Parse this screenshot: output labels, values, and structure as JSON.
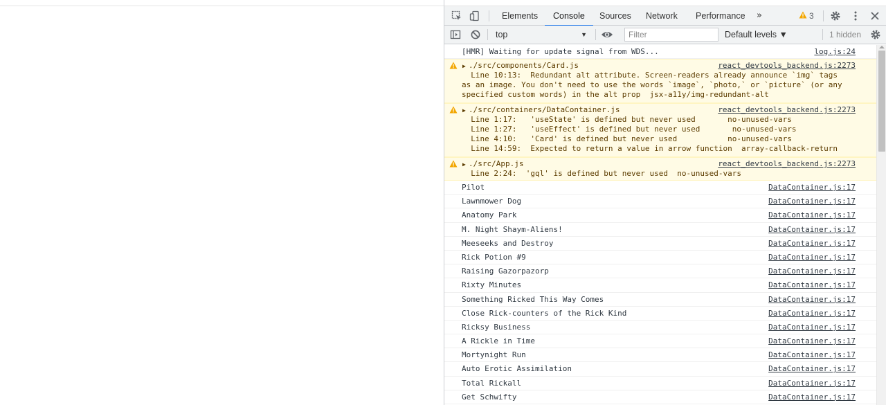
{
  "tabs": [
    "Elements",
    "Console",
    "Sources",
    "Network",
    "Performance"
  ],
  "active_tab": "Console",
  "more_tabs_label": "»",
  "warning_count": "3",
  "toolbar": {
    "context": "top",
    "filter_placeholder": "Filter",
    "levels": "Default levels ▼",
    "hidden": "1 hidden"
  },
  "messages": {
    "hmr": {
      "text": "[HMR] Waiting for update signal from WDS...",
      "src": "log.js:24"
    },
    "warn1": {
      "head": "./src/components/Card.js",
      "src": "react_devtools_backend.js:2273",
      "body": "  Line 10:13:  Redundant alt attribute. Screen-readers already announce `img` tags\nas an image. You don't need to use the words `image`, `photo,` or `picture` (or any\nspecified custom words) in the alt prop  jsx-a11y/img-redundant-alt"
    },
    "warn2": {
      "head": "./src/containers/DataContainer.js",
      "src": "react_devtools_backend.js:2273",
      "body": "  Line 1:17:   'useState' is defined but never used       no-unused-vars\n  Line 1:27:   'useEffect' is defined but never used       no-unused-vars\n  Line 4:10:   'Card' is defined but never used           no-unused-vars\n  Line 14:59:  Expected to return a value in arrow function  array-callback-return"
    },
    "warn3": {
      "head": "./src/App.js",
      "src": "react_devtools_backend.js:2273",
      "body": "  Line 2:24:  'gql' is defined but never used  no-unused-vars"
    }
  },
  "episodes": [
    {
      "text": "Pilot",
      "src": "DataContainer.js:17"
    },
    {
      "text": "Lawnmower Dog",
      "src": "DataContainer.js:17"
    },
    {
      "text": "Anatomy Park",
      "src": "DataContainer.js:17"
    },
    {
      "text": "M. Night Shaym-Aliens!",
      "src": "DataContainer.js:17"
    },
    {
      "text": "Meeseeks and Destroy",
      "src": "DataContainer.js:17"
    },
    {
      "text": "Rick Potion #9",
      "src": "DataContainer.js:17"
    },
    {
      "text": "Raising Gazorpazorp",
      "src": "DataContainer.js:17"
    },
    {
      "text": "Rixty Minutes",
      "src": "DataContainer.js:17"
    },
    {
      "text": "Something Ricked This Way Comes",
      "src": "DataContainer.js:17"
    },
    {
      "text": "Close Rick-counters of the Rick Kind",
      "src": "DataContainer.js:17"
    },
    {
      "text": "Ricksy Business",
      "src": "DataContainer.js:17"
    },
    {
      "text": "A Rickle in Time",
      "src": "DataContainer.js:17"
    },
    {
      "text": "Mortynight Run",
      "src": "DataContainer.js:17"
    },
    {
      "text": "Auto Erotic Assimilation",
      "src": "DataContainer.js:17"
    },
    {
      "text": "Total Rickall",
      "src": "DataContainer.js:17"
    },
    {
      "text": "Get Schwifty",
      "src": "DataContainer.js:17"
    }
  ],
  "colors": {
    "accent": "#1a73e8",
    "warning_bg": "#fffbe5",
    "warning_icon": "#f2a600"
  }
}
